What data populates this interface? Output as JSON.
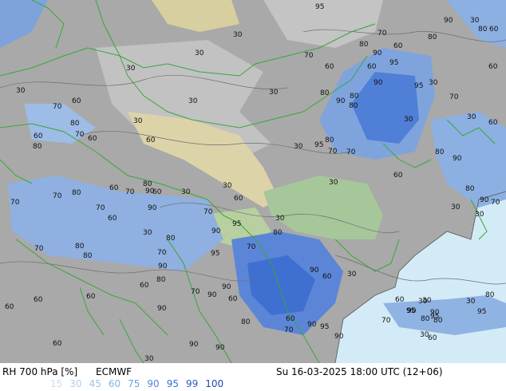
{
  "header": {
    "parameter": "RH 700 hPa [%]",
    "model": "ECMWF",
    "valid_time": "Su 16-03-2025 18:00 UTC (12+06)"
  },
  "legend": {
    "items": [
      {
        "value": "15",
        "color": "#c9dcee"
      },
      {
        "value": "30",
        "color": "#b3cfe9"
      },
      {
        "value": "45",
        "color": "#9fc2e4"
      },
      {
        "value": "60",
        "color": "#86b1df"
      },
      {
        "value": "75",
        "color": "#6c9fda"
      },
      {
        "value": "90",
        "color": "#4f86d6"
      },
      {
        "value": "95",
        "color": "#3a6fd2"
      },
      {
        "value": "99",
        "color": "#2a5bc4"
      },
      {
        "value": "100",
        "color": "#1e46b0"
      }
    ]
  },
  "contour_labels": [
    "95",
    "30",
    "90",
    "30",
    "80",
    "60",
    "30",
    "70",
    "60",
    "80",
    "70",
    "95",
    "30",
    "60",
    "60",
    "90",
    "30",
    "95",
    "80",
    "70",
    "30",
    "30",
    "90",
    "80",
    "70",
    "60",
    "30",
    "80",
    "90",
    "30",
    "80",
    "80",
    "60",
    "60",
    "30",
    "60",
    "30",
    "70",
    "60",
    "95",
    "80",
    "70",
    "80",
    "30",
    "80",
    "30",
    "70",
    "60",
    "80",
    "70",
    "30",
    "60",
    "90",
    "30",
    "70",
    "60",
    "90",
    "70",
    "80",
    "60",
    "90",
    "30",
    "70",
    "70",
    "80",
    "90",
    "30",
    "60",
    "30",
    "95",
    "80",
    "80",
    "70",
    "70",
    "80",
    "90",
    "30",
    "70",
    "80",
    "30",
    "90",
    "95",
    "60",
    "90",
    "80",
    "60",
    "90",
    "60",
    "30",
    "70",
    "90",
    "30",
    "60",
    "80",
    "90",
    "95",
    "90",
    "60",
    "80",
    "80",
    "60",
    "30",
    "60",
    "90",
    "95",
    "90",
    "70",
    "60",
    "95",
    "90",
    "60",
    "80",
    "30",
    "90",
    "90",
    "95",
    "70",
    "70",
    "30",
    "60",
    "60"
  ]
}
